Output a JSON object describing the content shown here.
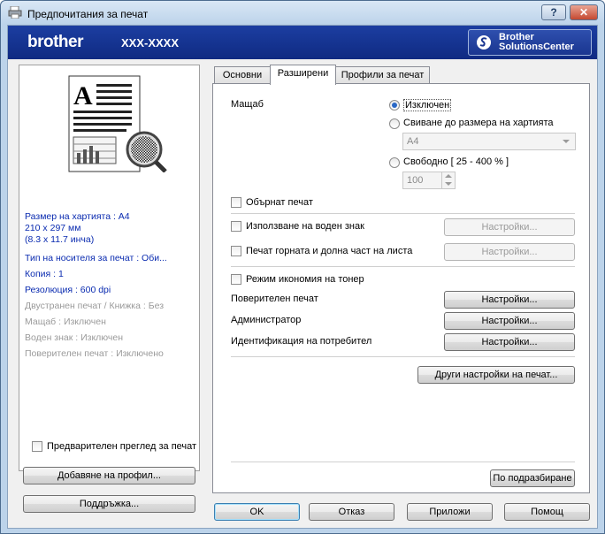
{
  "window": {
    "title": "Предпочитания за печат",
    "help": "?",
    "close": "✕"
  },
  "banner": {
    "logo": "brother",
    "model": "XXX-XXXX",
    "solutions_line1": "Brother",
    "solutions_line2": "SolutionsCenter"
  },
  "left": {
    "preview_letter": "A",
    "blue_info": [
      "Размер на хартията : A4",
      "210 x 297 мм",
      "(8.3 x 11.7 инча)",
      "Тип на носителя за печат : Оби...",
      "Копия : 1",
      "Резолюция : 600 dpi"
    ],
    "gray_info": [
      "Двустранен печат / Книжка : Без",
      "Мащаб : Изключен",
      "Воден знак : Изключен",
      "Поверителен печат : Изключено"
    ],
    "preview_checkbox": "Предварителен преглед за печат",
    "add_profile": "Добавяне на профил...",
    "support": "Поддръжка..."
  },
  "tabs": [
    "Основни",
    "Разширени",
    "Профили за печат"
  ],
  "advanced": {
    "scaling_label": "Мащаб",
    "opt_off": "Изключен",
    "opt_fit": "Свиване до размера на хартията",
    "paper_value": "A4",
    "opt_free": "Свободно [ 25 - 400 % ]",
    "free_value": "100",
    "mirror": "Обърнат печат",
    "watermark": "Използване на воден знак",
    "header_footer": "Печат горната и долна част на листа",
    "toner_save": "Режим икономия на тонер",
    "secure_print": "Поверителен печат",
    "administrator": "Администратор",
    "user_auth": "Идентификация на потребител",
    "settings": "Настройки...",
    "other_settings": "Други настройки на печат...",
    "default": "По подразбиране"
  },
  "footer": {
    "ok": "OK",
    "cancel": "Отказ",
    "apply": "Приложи",
    "help": "Помощ"
  }
}
